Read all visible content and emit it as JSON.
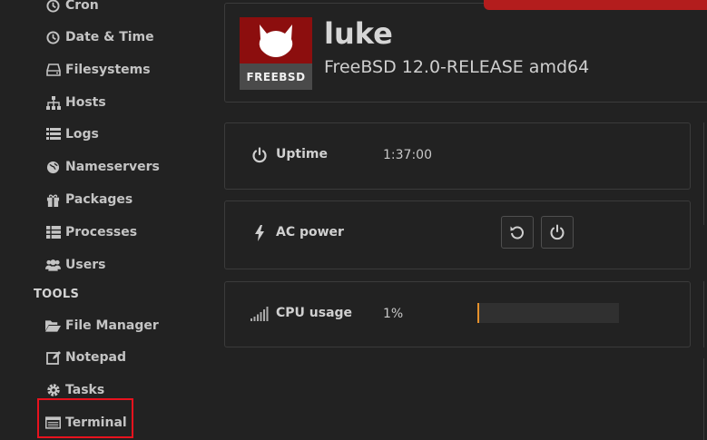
{
  "sidebar": {
    "items": [
      {
        "label": "Cron",
        "icon": "clock-icon"
      },
      {
        "label": "Date & Time",
        "icon": "clock-icon"
      },
      {
        "label": "Filesystems",
        "icon": "hard-drive-icon"
      },
      {
        "label": "Hosts",
        "icon": "sitemap-icon"
      },
      {
        "label": "Logs",
        "icon": "list-icon"
      },
      {
        "label": "Nameservers",
        "icon": "globe-icon"
      },
      {
        "label": "Packages",
        "icon": "gift-icon"
      },
      {
        "label": "Processes",
        "icon": "table-list-icon"
      },
      {
        "label": "Users",
        "icon": "users-icon"
      }
    ],
    "tools_heading": "TOOLS",
    "tools": [
      {
        "label": "File Manager",
        "icon": "folder-open-icon"
      },
      {
        "label": "Notepad",
        "icon": "edit-icon"
      },
      {
        "label": "Tasks",
        "icon": "cog-icon"
      },
      {
        "label": "Terminal",
        "icon": "terminal-icon"
      }
    ]
  },
  "header": {
    "hostname": "luke",
    "os": "FreeBSD 12.0-RELEASE amd64",
    "logo_text": "FREEBSD"
  },
  "cards": {
    "uptime": {
      "label": "Uptime",
      "value": "1:37:00"
    },
    "power": {
      "label": "AC power"
    },
    "cpu": {
      "label": "CPU usage",
      "value": "1%",
      "fraction": 0.01
    }
  },
  "colors": {
    "accent": "#e6912c",
    "highlight": "#e8121e",
    "logo_red": "#8c0e0e",
    "background": "#222222"
  }
}
